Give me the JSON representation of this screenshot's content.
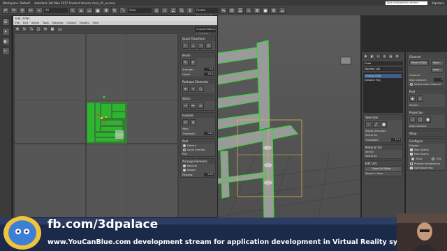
{
  "titlebar": {
    "workspace": "Workspace: Default",
    "title": "Autodesk 3ds Max 2017   Student Version   chair_01_uv.max",
    "search_placeholder": "Type a keyword or phrase",
    "user": "3dpalace"
  },
  "toolbar": {
    "selection_filter": "All",
    "view": "View",
    "selection_set": "Create Selection Se"
  },
  "uvw_editor": {
    "title": "Edit UVWs",
    "menu": [
      "File",
      "Edit",
      "Select",
      "Tools",
      "Mapping",
      "Options",
      "Display",
      "View"
    ],
    "channel_label": "UV",
    "checker": "CheckerPattern  ( Checker )",
    "side": {
      "quick_transform": "Quick Transform",
      "brush": "Brush",
      "strength_label": "Strength:",
      "strength_value": "0.5",
      "falloff_label": "Falloff:",
      "falloff_value": "20.0",
      "reshape_elements": "Reshape Elements",
      "stitch": "Stitch",
      "explode": "Explode",
      "weld": "Weld",
      "threshold_label": "Threshold:",
      "threshold_value": "0.01",
      "peel": "Peel",
      "detach": "Detach",
      "avoid_overlap": "Avoid Overlap",
      "pins": "Pins",
      "arrange_elements": "Arrange Elements",
      "rescale": "Rescale",
      "rotate": "Rotate",
      "padding_label": "Padding:",
      "padding_value": "0.02"
    }
  },
  "command_panel": {
    "object_name": "Chair",
    "modifier_list": "Modifier List",
    "stack": [
      "Unwrap UVW",
      "Editable Poly"
    ],
    "selection": "Selection",
    "modify_selection": "Modify Selection",
    "select_by": "Select By:",
    "threshold_label": "Threshold:",
    "threshold_value": "15.0",
    "material_ids": "Material IDs",
    "set_id": "Set ID:",
    "select_id": "Select ID:",
    "edit_uvs": "Edit UVs",
    "open_uv_editor": "Open UV Editor ...",
    "tweak_in_view": "Tweak In View"
  },
  "channel_panel": {
    "channel": "Channel",
    "reset_uvws": "Reset UVWs",
    "save": "Save...",
    "load": "Load...",
    "channel_sub": "Channel:",
    "map_channel_label": "Map Channel:",
    "map_channel_value": "1",
    "vertex_color_channel": "Vertex Color Channel",
    "peel": "Peel",
    "seams": "Seams:",
    "projection": "Projection",
    "align_options": "Align Options:",
    "wrap": "Wrap",
    "configure": "Configure",
    "display": "Display:",
    "map_seams": "Map Seams",
    "peel_seams": "Peel Seams",
    "thick": "Thick",
    "thin": "Thin",
    "prevent_reflattening": "Prevent Reflattening",
    "normalize_map": "Normalize Map"
  },
  "overlay": {
    "fb": "fb.com/3dpalace",
    "url": "www.YouCanBlue.com development stream for application development in Virtual Reality systems."
  }
}
